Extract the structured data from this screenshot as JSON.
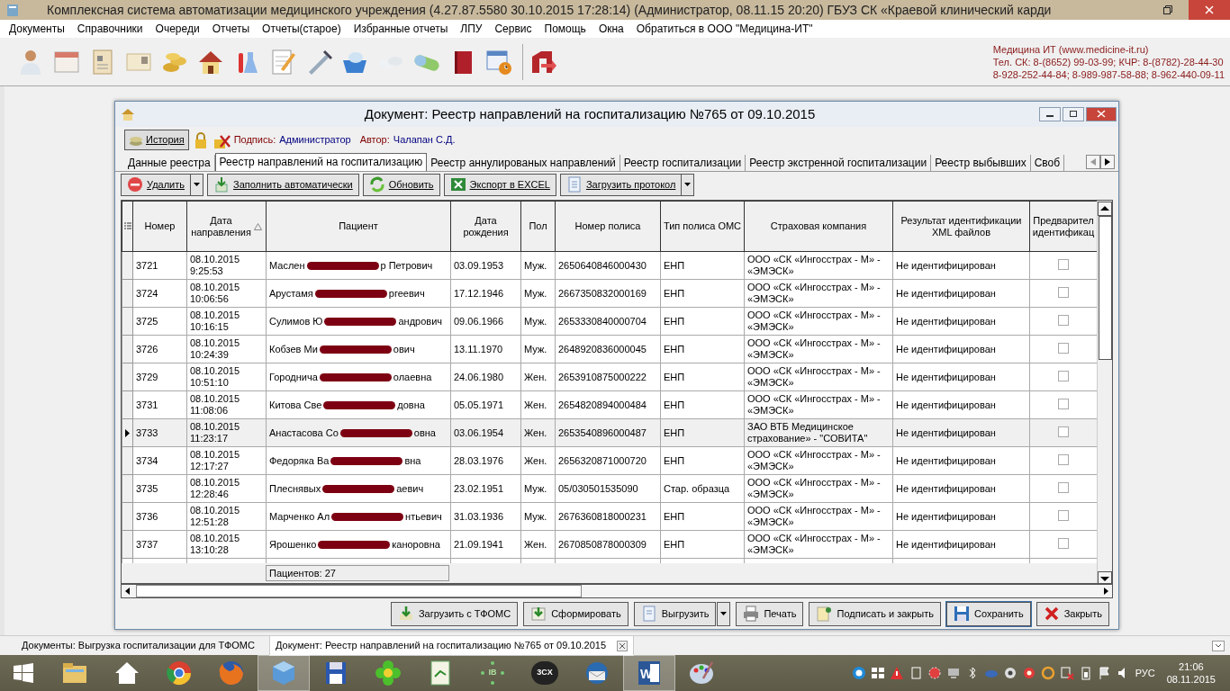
{
  "window": {
    "title": "Комплексная система автоматизации медицинского учреждения (4.27.87.5580 30.10.2015 17:28:14) (Администратор, 08.11.15 20:20) ГБУЗ СК «Краевой клинический карди"
  },
  "menu": [
    "Документы",
    "Справочники",
    "Очереди",
    "Отчеты",
    "Отчеты(старое)",
    "Избранные отчеты",
    "ЛПУ",
    "Сервис",
    "Помощь",
    "Окна",
    "Обратиться в ООО \"Медицина-ИТ\""
  ],
  "contact": [
    "Медицина ИТ (www.medicine-it.ru)",
    "Тел. СК: 8-(8652) 99-03-99; КЧР: 8-(8782)-28-44-30",
    "8-928-252-44-84; 8-989-987-58-88; 8-962-440-09-11"
  ],
  "document": {
    "title": "Документ: Реестр направлений на госпитализацию №765 от 09.10.2015",
    "history_button": "История",
    "signature_label": "Подпись:",
    "signature": "Администратор",
    "author_label": "Автор:",
    "author": "Чалапан С.Д.",
    "tabs": [
      {
        "label": "Данные реестра",
        "selected": false
      },
      {
        "label": "Реестр направлений на госпитализацию",
        "selected": true
      },
      {
        "label": "Реестр аннулированых направлений",
        "selected": false
      },
      {
        "label": "Реестр госпитализации",
        "selected": false
      },
      {
        "label": "Реестр экстренной госпитализации",
        "selected": false
      },
      {
        "label": "Реестр выбывших",
        "selected": false
      },
      {
        "label": "Своб",
        "selected": false
      }
    ],
    "actions": [
      {
        "label": "Удалить",
        "dropdown": true
      },
      {
        "label": "Заполнить автоматически",
        "dropdown": false
      },
      {
        "label": "Обновить",
        "dropdown": false
      },
      {
        "label": "Экспорт в EXCEL",
        "dropdown": false
      },
      {
        "label": "Загрузить протокол",
        "dropdown": true
      }
    ],
    "table": {
      "columns": [
        "Номер",
        "Дата направления",
        "Пациент",
        "Дата рождения",
        "Пол",
        "Номер полиса",
        "Тип полиса ОМС",
        "Страховая компания",
        "Результат идентификации XML файлов",
        "Предварител идентификац"
      ],
      "rows": [
        {
          "number": "3721",
          "date": "08.10.2015 9:25:53",
          "patient": [
            "Маслен",
            "р Петрович"
          ],
          "birth": "03.09.1953",
          "sex": "Муж.",
          "policy": "2650640846000430",
          "policy_type": "ЕНП",
          "insurer": "ООО «СК «Ингосстрах - М» - «ЭМЭСК»",
          "result": "Не идентифицирован",
          "preliminary": false,
          "selected": false
        },
        {
          "number": "3724",
          "date": "08.10.2015 10:06:56",
          "patient": [
            "Арустамя",
            "ргеевич"
          ],
          "birth": "17.12.1946",
          "sex": "Муж.",
          "policy": "2667350832000169",
          "policy_type": "ЕНП",
          "insurer": "ООО «СК «Ингосстрах - М» - «ЭМЭСК»",
          "result": "Не идентифицирован",
          "preliminary": false,
          "selected": false
        },
        {
          "number": "3725",
          "date": "08.10.2015 10:16:15",
          "patient": [
            "Сулимов Ю",
            "андрович"
          ],
          "birth": "09.06.1966",
          "sex": "Муж.",
          "policy": "2653330840000704",
          "policy_type": "ЕНП",
          "insurer": "ООО «СК «Ингосстрах - М» - «ЭМЭСК»",
          "result": "Не идентифицирован",
          "preliminary": false,
          "selected": false
        },
        {
          "number": "3726",
          "date": "08.10.2015 10:24:39",
          "patient": [
            "Кобзев Ми",
            "ович"
          ],
          "birth": "13.11.1970",
          "sex": "Муж.",
          "policy": "2648920836000045",
          "policy_type": "ЕНП",
          "insurer": "ООО «СК «Ингосстрах - М» - «ЭМЭСК»",
          "result": "Не идентифицирован",
          "preliminary": false,
          "selected": false
        },
        {
          "number": "3729",
          "date": "08.10.2015 10:51:10",
          "patient": [
            "Городнича",
            "олаевна"
          ],
          "birth": "24.06.1980",
          "sex": "Жен.",
          "policy": "2653910875000222",
          "policy_type": "ЕНП",
          "insurer": "ООО «СК «Ингосстрах - М» - «ЭМЭСК»",
          "result": "Не идентифицирован",
          "preliminary": false,
          "selected": false
        },
        {
          "number": "3731",
          "date": "08.10.2015 11:08:06",
          "patient": [
            "Китова Све",
            "довна"
          ],
          "birth": "05.05.1971",
          "sex": "Жен.",
          "policy": "2654820894000484",
          "policy_type": "ЕНП",
          "insurer": "ООО «СК «Ингосстрах - М» - «ЭМЭСК»",
          "result": "Не идентифицирован",
          "preliminary": false,
          "selected": false
        },
        {
          "number": "3733",
          "date": "08.10.2015 11:23:17",
          "patient": [
            "Анастасова Со",
            "овна"
          ],
          "birth": "03.06.1954",
          "sex": "Жен.",
          "policy": "2653540896000487",
          "policy_type": "ЕНП",
          "insurer": "ЗАО ВТБ Медицинское страхование» - \"СОВИТА\"",
          "result": "Не идентифицирован",
          "preliminary": false,
          "selected": true
        },
        {
          "number": "3734",
          "date": "08.10.2015 12:17:27",
          "patient": [
            "Федоряка Ва",
            "вна"
          ],
          "birth": "28.03.1976",
          "sex": "Жен.",
          "policy": "2656320871000720",
          "policy_type": "ЕНП",
          "insurer": "ООО «СК «Ингосстрах - М» - «ЭМЭСК»",
          "result": "Не идентифицирован",
          "preliminary": false,
          "selected": false
        },
        {
          "number": "3735",
          "date": "08.10.2015 12:28:46",
          "patient": [
            "Плеснявых",
            "аевич"
          ],
          "birth": "23.02.1951",
          "sex": "Муж.",
          "policy": "05/030501535090",
          "policy_type": "Стар. образца",
          "insurer": "ООО «СК «Ингосстрах - М» - «ЭМЭСК»",
          "result": "Не идентифицирован",
          "preliminary": false,
          "selected": false
        },
        {
          "number": "3736",
          "date": "08.10.2015 12:51:28",
          "patient": [
            "Марченко Ал",
            "нтьевич"
          ],
          "birth": "31.03.1936",
          "sex": "Муж.",
          "policy": "2676360818000231",
          "policy_type": "ЕНП",
          "insurer": "ООО «СК «Ингосстрах - М» - «ЭМЭСК»",
          "result": "Не идентифицирован",
          "preliminary": false,
          "selected": false
        },
        {
          "number": "3737",
          "date": "08.10.2015 13:10:28",
          "patient": [
            "Ярошенко",
            "каноровна"
          ],
          "birth": "21.09.1941",
          "sex": "Жен.",
          "policy": "2670850878000309",
          "policy_type": "ЕНП",
          "insurer": "ООО «СК «Ингосстрах - М» - «ЭМЭСК»",
          "result": "Не идентифицирован",
          "preliminary": false,
          "selected": false
        }
      ]
    },
    "patients_count": "Пациентов: 27",
    "bottom_buttons": [
      {
        "label": "Загрузить с ТФОМС",
        "dropdown": false
      },
      {
        "label": "Сформировать",
        "dropdown": false
      },
      {
        "label": "Выгрузить",
        "dropdown": true
      },
      {
        "label": "Печать",
        "dropdown": false
      },
      {
        "label": "Подписать и закрыть",
        "dropdown": false
      },
      {
        "label": "Сохранить",
        "dropdown": false
      },
      {
        "label": "Закрыть",
        "dropdown": false
      }
    ]
  },
  "mdi_tabs": [
    {
      "label": "Документы: Выгрузка госпитализации для ТФОМС",
      "selected": false
    },
    {
      "label": "Документ: Реестр направлений на госпитализацию №765 от 09.10.2015",
      "selected": true
    }
  ],
  "taskbar": [
    {
      "kind": "folder",
      "selected": false
    },
    {
      "kind": "home",
      "selected": false
    },
    {
      "kind": "browser",
      "selected": false
    },
    {
      "kind": "fox",
      "selected": false
    },
    {
      "kind": "cube",
      "selected": true
    },
    {
      "kind": "floppy",
      "selected": false
    },
    {
      "kind": "flower",
      "selected": false
    },
    {
      "kind": "notepad",
      "selected": false
    },
    {
      "kind": "dots",
      "text": "IB",
      "selected": false
    },
    {
      "kind": "badge",
      "text": "3CX",
      "selected": false
    },
    {
      "kind": "bird",
      "selected": false
    },
    {
      "kind": "word",
      "text": "W",
      "selected": true
    },
    {
      "kind": "palette",
      "selected": false
    }
  ],
  "language": "РУС",
  "clock": {
    "time": "21:06",
    "date": "08.11.2015"
  }
}
